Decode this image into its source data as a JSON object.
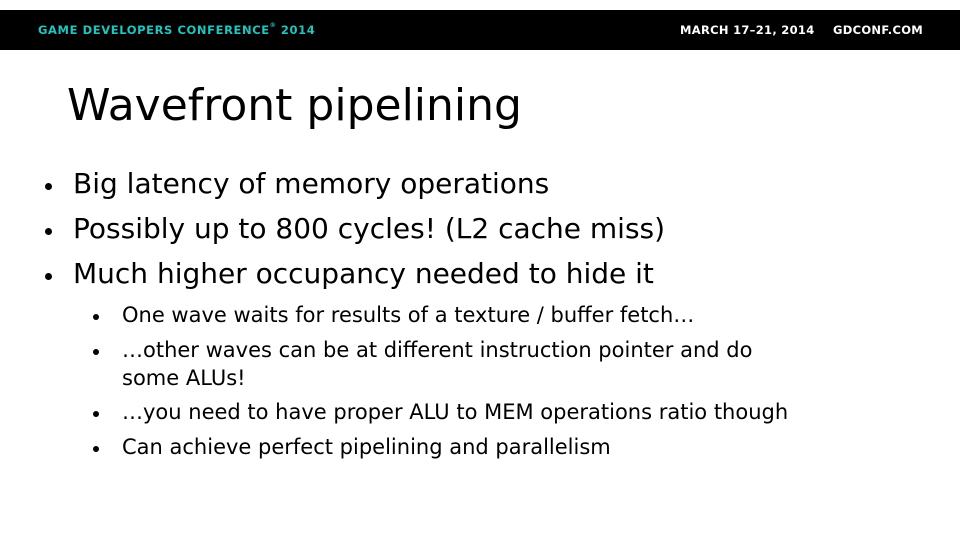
{
  "header": {
    "conference_name": "GAME DEVELOPERS CONFERENCE",
    "conference_mark": "®",
    "conference_year": "2014",
    "dates": "MARCH 17–21, 2014",
    "website": "GDCONF.COM",
    "accent_color": "#1fc5bf",
    "bar_color": "#000000"
  },
  "slide": {
    "title": "Wavefront pipelining",
    "bullets": [
      "Big latency of memory operations",
      "Possibly up to 800 cycles! (L2 cache miss)",
      "Much higher occupancy needed to hide it"
    ],
    "sub_bullets": [
      {
        "line1": "One wave waits for results of a texture / buffer fetch…"
      },
      {
        "line1": "…other waves can be at different instruction pointer and do",
        "line2": "some ALUs!"
      },
      {
        "line1": "…you need to have proper ALU to MEM operations ratio though"
      },
      {
        "line1": "Can achieve perfect pipelining and parallelism"
      }
    ]
  }
}
